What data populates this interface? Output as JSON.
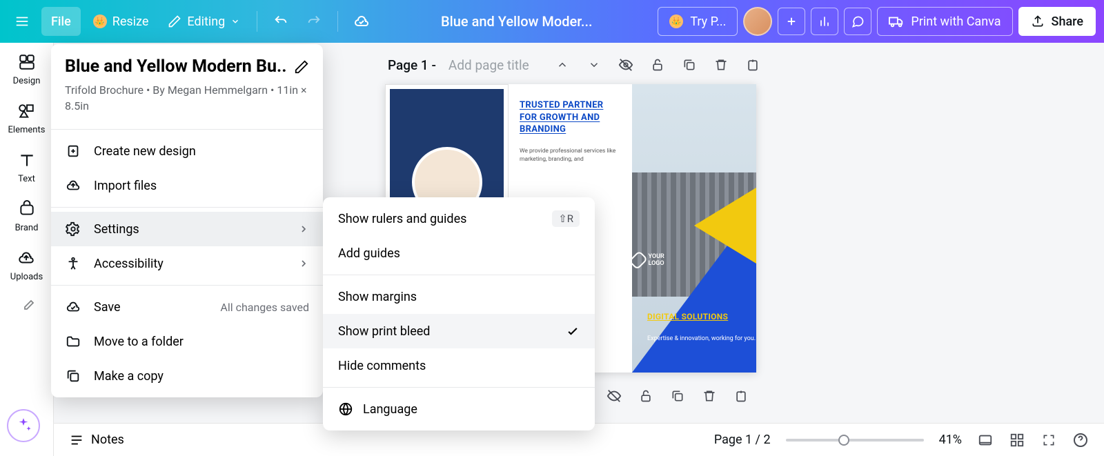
{
  "topbar": {
    "file": "File",
    "resize": "Resize",
    "editing": "Editing",
    "doc_title": "Blue and Yellow Moder...",
    "try": "Try P...",
    "print": "Print with Canva",
    "share": "Share"
  },
  "rail": {
    "design": "Design",
    "elements": "Elements",
    "text": "Text",
    "brand": "Brand",
    "uploads": "Uploads"
  },
  "file_menu": {
    "title": "Blue and Yellow Modern Bu..",
    "subtitle": "Trifold Brochure • By Megan Hemmelgarn • 11in × 8.5in",
    "create": "Create new design",
    "import": "Import files",
    "settings": "Settings",
    "accessibility": "Accessibility",
    "save": "Save",
    "save_status": "All changes saved",
    "move": "Move to a folder",
    "copy": "Make a copy"
  },
  "settings_menu": {
    "rulers": "Show rulers and guides",
    "rulers_short": "⇧R",
    "add_guides": "Add guides",
    "margins": "Show margins",
    "bleed": "Show print bleed",
    "comments": "Hide comments",
    "language": "Language"
  },
  "page_header": {
    "label": "Page 1 -",
    "placeholder": "Add page title"
  },
  "canvas": {
    "panel2_heading": "TRUSTED PARTNER FOR GROWTH AND BRANDING",
    "panel2_text": "We provide professional services like marketing, branding, and",
    "panel3_logo": "YOUR LOGO",
    "panel3_heading": "DIGITAL SOLUTIONS",
    "panel3_sub": "Expertise & innovation, working for you."
  },
  "bottom": {
    "notes": "Notes",
    "page": "Page 1 / 2",
    "zoom": "41%"
  }
}
